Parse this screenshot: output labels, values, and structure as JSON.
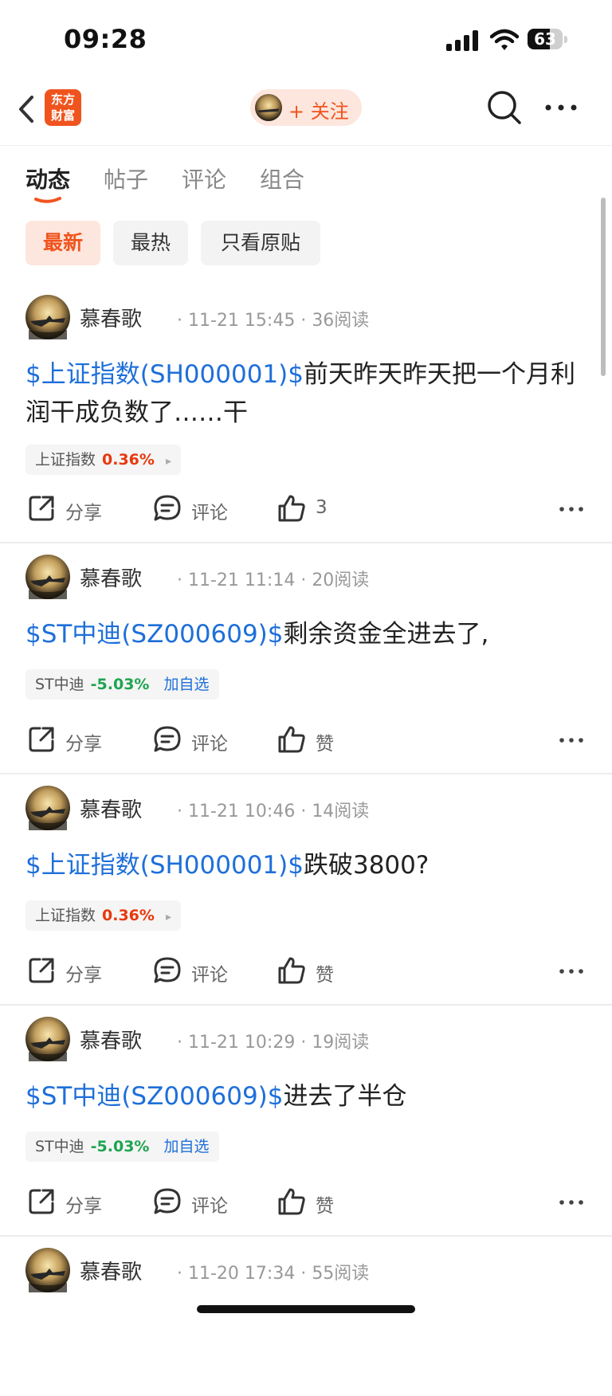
{
  "status_bar": {
    "time": "09:28",
    "battery_level": "63",
    "battery_fraction": 0.63
  },
  "header": {
    "logo_text_line1": "东方",
    "logo_text_line2": "财富",
    "follow_label": "+ 关注"
  },
  "tabs": [
    {
      "label": "动态",
      "active": true
    },
    {
      "label": "帖子",
      "active": false
    },
    {
      "label": "评论",
      "active": false
    },
    {
      "label": "组合",
      "active": false
    }
  ],
  "filters": [
    {
      "label": "最新",
      "active": true
    },
    {
      "label": "最热",
      "active": false
    },
    {
      "label": "只看原贴",
      "active": false
    }
  ],
  "action_labels": {
    "share": "分享",
    "comment": "评论",
    "like": "赞"
  },
  "posts": [
    {
      "author": "慕春歌",
      "date": "11-21 15:45",
      "reads": "36阅读",
      "tag": "$上证指数(SH000001)$",
      "text": "前天昨天昨天把一个月利润干成负数了……干",
      "stock": {
        "name": "上证指数",
        "change": "0.36%",
        "direction": "up",
        "extra": "▸"
      },
      "likes": "3"
    },
    {
      "author": "慕春歌",
      "date": "11-21 11:14",
      "reads": "20阅读",
      "tag": "$ST中迪(SZ000609)$",
      "text": "剩余资金全进去了,",
      "stock": {
        "name": "ST中迪",
        "change": "-5.03%",
        "direction": "down",
        "extra": "加自选"
      },
      "likes": "赞"
    },
    {
      "author": "慕春歌",
      "date": "11-21 10:46",
      "reads": "14阅读",
      "tag": "$上证指数(SH000001)$",
      "text": "跌破3800?",
      "stock": {
        "name": "上证指数",
        "change": "0.36%",
        "direction": "up",
        "extra": "▸"
      },
      "likes": "赞"
    },
    {
      "author": "慕春歌",
      "date": "11-21 10:29",
      "reads": "19阅读",
      "tag": "$ST中迪(SZ000609)$",
      "text": "进去了半仓",
      "stock": {
        "name": "ST中迪",
        "change": "-5.03%",
        "direction": "down",
        "extra": "加自选"
      },
      "likes": "赞"
    },
    {
      "author": "慕春歌",
      "date": "11-20 17:34",
      "reads": "55阅读"
    }
  ],
  "colors": {
    "brand": "#f0541e",
    "link": "#1e6fd9",
    "up": "#e8380d",
    "down": "#1ea450"
  },
  "icons": [
    "back-arrow-icon",
    "search-icon",
    "more-dots-icon",
    "share-icon",
    "comment-icon",
    "thumbs-up-icon"
  ]
}
